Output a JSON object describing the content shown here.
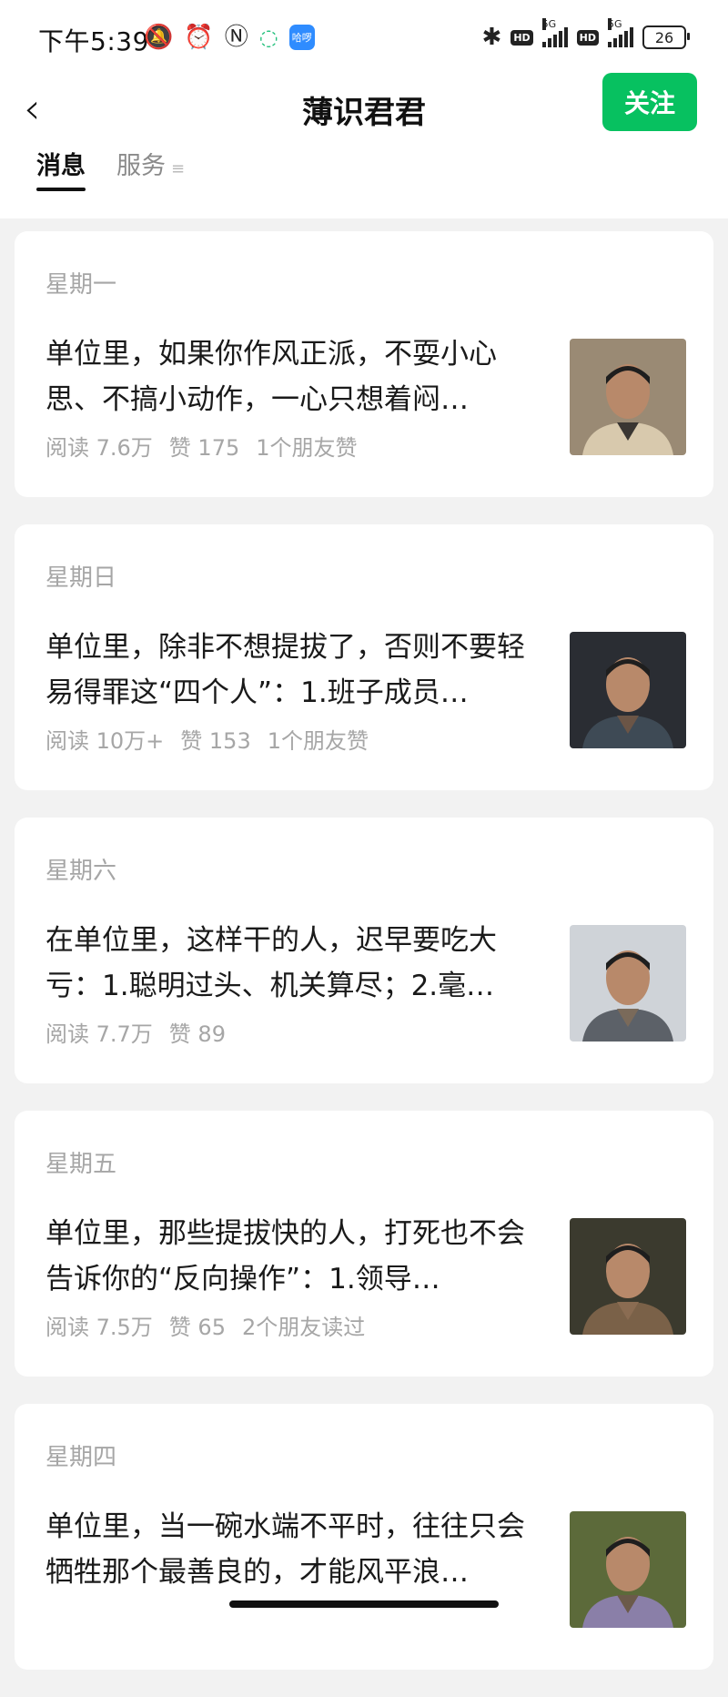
{
  "status_bar": {
    "time": "下午5:39",
    "app_badge": "哈啰",
    "battery": "26",
    "network": "5G",
    "hd": "HD"
  },
  "nav": {
    "back_icon": "chevron-left-icon",
    "title": "薄识君君",
    "follow_label": "关注"
  },
  "tabs": [
    {
      "label": "消息",
      "active": true
    },
    {
      "label": "服务",
      "active": false
    }
  ],
  "articles": [
    {
      "day": "星期一",
      "headline": "单位里，如果你作风正派，不耍小心思、不搞小动作，一心只想着闷…",
      "reads": "阅读 7.6万",
      "likes": "赞 175",
      "social": "1个朋友赞",
      "thumb_colors": [
        "#9a8a74",
        "#3a3632",
        "#d8c9ad"
      ]
    },
    {
      "day": "星期日",
      "headline": "单位里，除非不想提拔了，否则不要轻易得罪这“四个人”：1.班子成员…",
      "reads": "阅读 10万+",
      "likes": "赞 153",
      "social": "1个朋友赞",
      "thumb_colors": [
        "#2a2d33",
        "#6b5546",
        "#3e4a55"
      ]
    },
    {
      "day": "星期六",
      "headline": "在单位里，这样干的人，迟早要吃大亏：1.聪明过头、机关算尽；2.毫…",
      "reads": "阅读 7.7万",
      "likes": "赞 89",
      "social": "",
      "thumb_colors": [
        "#cfd3d8",
        "#7a6a5a",
        "#5c6168"
      ]
    },
    {
      "day": "星期五",
      "headline": "单位里，那些提拔快的人，打死也不会告诉你的“反向操作”：1.领导…",
      "reads": "阅读 7.5万",
      "likes": "赞 65",
      "social": "2个朋友读过",
      "thumb_colors": [
        "#3b3a2e",
        "#8a6c52",
        "#7a6148"
      ]
    },
    {
      "day": "星期四",
      "headline": "单位里，当一碗水端不平时，往往只会牺牲那个最善良的，才能风平浪…",
      "reads": "",
      "likes": "",
      "social": "",
      "thumb_colors": [
        "#5c6a3a",
        "#6b5a4a",
        "#8a7fa8"
      ]
    }
  ]
}
